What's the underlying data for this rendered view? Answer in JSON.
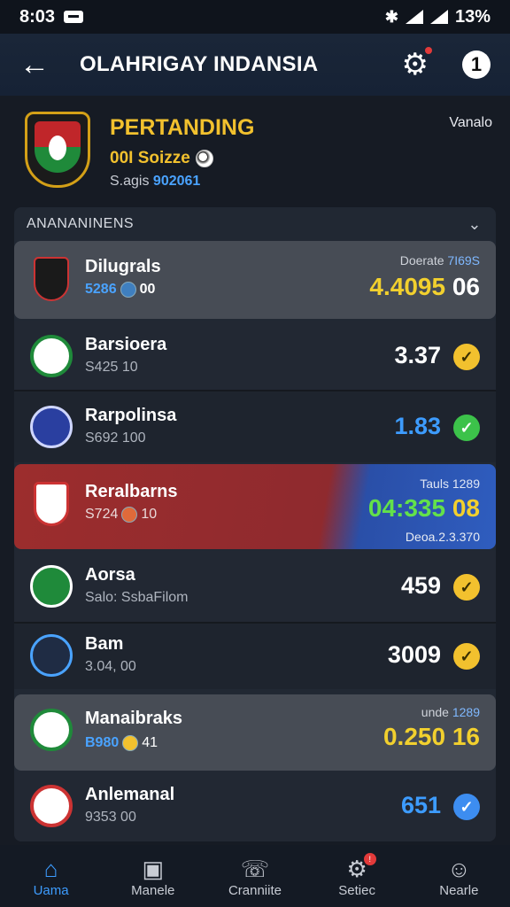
{
  "status_bar": {
    "time": "8:03",
    "battery": "13%"
  },
  "app_bar": {
    "title": "OLAHRIGAY INDANSIA"
  },
  "header": {
    "title": "PERTANDING",
    "subtitle": "00I Soizze",
    "meta_label": "S.agis",
    "meta_value": "902061",
    "right_label": "Vanalo"
  },
  "panel": {
    "title": "ANANANINENS"
  },
  "rows": [
    {
      "team": "Dilugrals",
      "sub_a": "5286",
      "sub_b": "00",
      "top": "Doerate",
      "top_b": "7I69S",
      "odds_a": "4.4095",
      "odds_b": "06"
    },
    {
      "team": "Barsioera",
      "sub": "S425 10",
      "odds": "3.37"
    },
    {
      "team": "Rarpolinsa",
      "sub": "S692 100",
      "odds": "1.83"
    },
    {
      "team": "Reralbarns",
      "sub_a": "S724",
      "sub_b": "10",
      "top": "Tauls",
      "top_b": "1289",
      "odds_a": "04:335",
      "odds_b": "08",
      "bottom": "Deoa.2.3.370"
    },
    {
      "team": "Aorsa",
      "sub": "Salo: SsbaFilom",
      "odds": "459"
    },
    {
      "team": "Bam",
      "sub": "3.04, 00",
      "odds": "3009"
    },
    {
      "team": "Manaibraks",
      "sub_a": "B980",
      "sub_b": "41",
      "top": "unde",
      "top_b": "1289",
      "odds_a": "0.250",
      "odds_b": "16"
    },
    {
      "team": "Anlemanal",
      "sub": "9353 00",
      "odds": "651"
    }
  ],
  "nav": [
    {
      "label": "Uama",
      "icon": "home-icon"
    },
    {
      "label": "Manele",
      "icon": "tv-icon"
    },
    {
      "label": "Cranniite",
      "icon": "phone-icon"
    },
    {
      "label": "Setiec",
      "icon": "settings-icon"
    },
    {
      "label": "Nearle",
      "icon": "person-icon"
    }
  ],
  "colors": {
    "accent": "#3d9cff",
    "gold": "#f2c12e",
    "red_row": "#9c2d2d",
    "blue_row": "#2f5dbf"
  }
}
